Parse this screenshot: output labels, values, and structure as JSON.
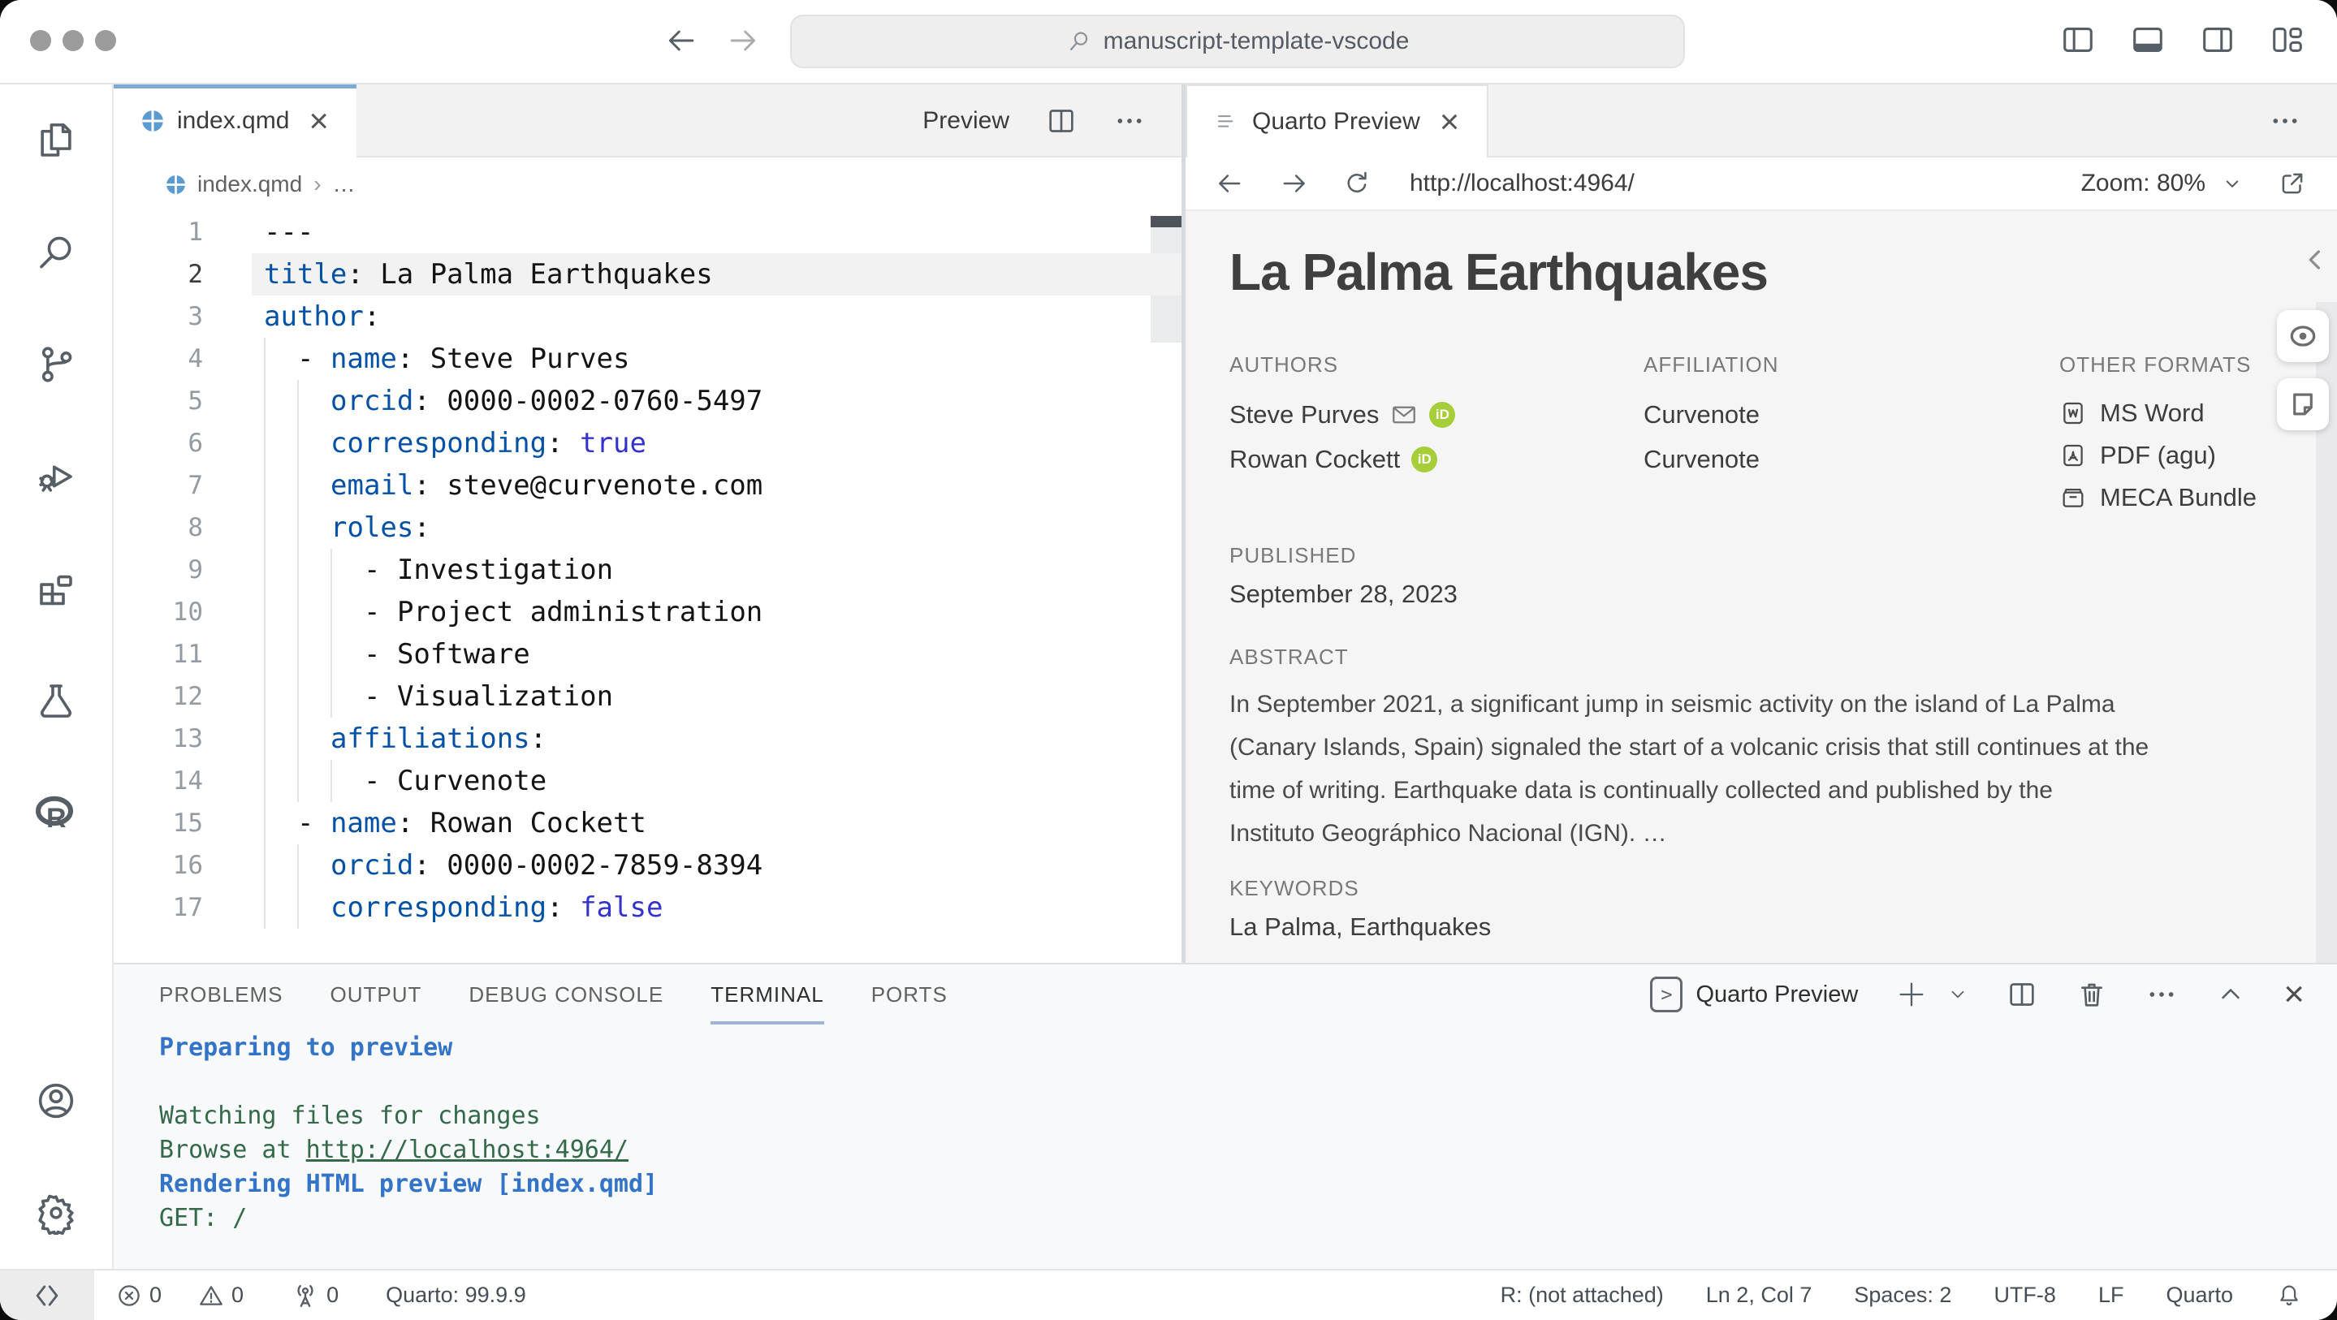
{
  "titlebar": {
    "search_text": "manuscript-template-vscode"
  },
  "editor": {
    "tab_title": "index.qmd",
    "close_label": "×",
    "preview_label": "Preview",
    "breadcrumb_file": "index.qmd",
    "breadcrumb_sep": "›",
    "breadcrumb_more": "…",
    "lines": [
      {
        "n": "1",
        "indent": 0,
        "guides": 0,
        "segs": [
          [
            "p",
            "---"
          ]
        ]
      },
      {
        "n": "2",
        "indent": 0,
        "guides": 0,
        "hl": true,
        "segs": [
          [
            "k",
            "title"
          ],
          [
            "p",
            ": La Palma Earthquakes"
          ]
        ]
      },
      {
        "n": "3",
        "indent": 0,
        "guides": 0,
        "segs": [
          [
            "k",
            "author"
          ],
          [
            "p",
            ":"
          ]
        ]
      },
      {
        "n": "4",
        "indent": 2,
        "guides": 1,
        "segs": [
          [
            "p",
            "- "
          ],
          [
            "k",
            "name"
          ],
          [
            "p",
            ": Steve Purves"
          ]
        ]
      },
      {
        "n": "5",
        "indent": 4,
        "guides": 2,
        "segs": [
          [
            "k",
            "orcid"
          ],
          [
            "p",
            ": 0000-0002-0760-5497"
          ]
        ]
      },
      {
        "n": "6",
        "indent": 4,
        "guides": 2,
        "segs": [
          [
            "k",
            "corresponding"
          ],
          [
            "p",
            ": "
          ],
          [
            "b",
            "true"
          ]
        ]
      },
      {
        "n": "7",
        "indent": 4,
        "guides": 2,
        "segs": [
          [
            "k",
            "email"
          ],
          [
            "p",
            ": steve@curvenote.com"
          ]
        ]
      },
      {
        "n": "8",
        "indent": 4,
        "guides": 2,
        "segs": [
          [
            "k",
            "roles"
          ],
          [
            "p",
            ":"
          ]
        ]
      },
      {
        "n": "9",
        "indent": 6,
        "guides": 3,
        "segs": [
          [
            "p",
            "- Investigation"
          ]
        ]
      },
      {
        "n": "10",
        "indent": 6,
        "guides": 3,
        "segs": [
          [
            "p",
            "- Project administration"
          ]
        ]
      },
      {
        "n": "11",
        "indent": 6,
        "guides": 3,
        "segs": [
          [
            "p",
            "- Software"
          ]
        ]
      },
      {
        "n": "12",
        "indent": 6,
        "guides": 3,
        "segs": [
          [
            "p",
            "- Visualization"
          ]
        ]
      },
      {
        "n": "13",
        "indent": 4,
        "guides": 2,
        "segs": [
          [
            "k",
            "affiliations"
          ],
          [
            "p",
            ":"
          ]
        ]
      },
      {
        "n": "14",
        "indent": 6,
        "guides": 3,
        "segs": [
          [
            "p",
            "- Curvenote"
          ]
        ]
      },
      {
        "n": "15",
        "indent": 2,
        "guides": 1,
        "segs": [
          [
            "p",
            "- "
          ],
          [
            "k",
            "name"
          ],
          [
            "p",
            ": Rowan Cockett"
          ]
        ]
      },
      {
        "n": "16",
        "indent": 4,
        "guides": 2,
        "segs": [
          [
            "k",
            "orcid"
          ],
          [
            "p",
            ": 0000-0002-7859-8394"
          ]
        ]
      },
      {
        "n": "17",
        "indent": 4,
        "guides": 2,
        "segs": [
          [
            "k",
            "corresponding"
          ],
          [
            "p",
            ": "
          ],
          [
            "b",
            "false"
          ]
        ]
      }
    ]
  },
  "preview": {
    "tab_title": "Quarto Preview",
    "close_label": "×",
    "url": "http://localhost:4964/",
    "zoom_label": "Zoom: 80%",
    "doc": {
      "title": "La Palma Earthquakes",
      "authors_label": "AUTHORS",
      "affiliation_label": "AFFILIATION",
      "formats_label": "OTHER FORMATS",
      "authors": [
        {
          "name": "Steve Purves",
          "has_email": true,
          "has_orcid": true
        },
        {
          "name": "Rowan Cockett",
          "has_email": false,
          "has_orcid": true
        }
      ],
      "orcid_badge": "iD",
      "affiliations": [
        "Curvenote",
        "Curvenote"
      ],
      "formats": [
        {
          "icon": "ms-word-icon",
          "label": "MS Word"
        },
        {
          "icon": "pdf-icon",
          "label": "PDF (agu)"
        },
        {
          "icon": "meca-icon",
          "label": "MECA Bundle"
        }
      ],
      "published_label": "PUBLISHED",
      "published": "September 28, 2023",
      "abstract_label": "ABSTRACT",
      "abstract_lines": [
        "In September 2021, a significant jump in seismic activity on the island of La Palma",
        "(Canary Islands, Spain) signaled the start of a volcanic crisis that still continues at the",
        "time of writing. Earthquake data is continually collected and published by the",
        "Instituto Geográphico Nacional (IGN). …"
      ],
      "keywords_label": "KEYWORDS",
      "keywords": "La Palma, Earthquakes"
    }
  },
  "panel": {
    "tabs": [
      "PROBLEMS",
      "OUTPUT",
      "DEBUG CONSOLE",
      "TERMINAL",
      "PORTS"
    ],
    "active_tab": "TERMINAL",
    "terminal_name": "Quarto Preview",
    "terminal_lines": [
      {
        "text": "Preparing to preview",
        "style": "blue"
      },
      {
        "text": "",
        "style": "green"
      },
      {
        "text": "Watching files for changes",
        "style": "green"
      },
      {
        "text": "Browse at ",
        "style": "green",
        "link": "http://localhost:4964/"
      },
      {
        "text": "Rendering HTML preview [index.qmd]",
        "style": "blue"
      },
      {
        "text": "GET: /",
        "style": "green"
      }
    ]
  },
  "statusbar": {
    "errors": "0",
    "warnings": "0",
    "ports": "0",
    "quarto_version": "Quarto: 99.9.9",
    "r_status": "R: (not attached)",
    "cursor": "Ln 2, Col 7",
    "indent": "Spaces: 2",
    "encoding": "UTF-8",
    "eol": "LF",
    "language": "Quarto"
  },
  "colors": {
    "tab_accent": "#7faad6",
    "yaml_key": "#0451a5",
    "terminal_blue": "#3474c8",
    "terminal_green": "#34694a",
    "orcid_green": "#a6ce39"
  }
}
